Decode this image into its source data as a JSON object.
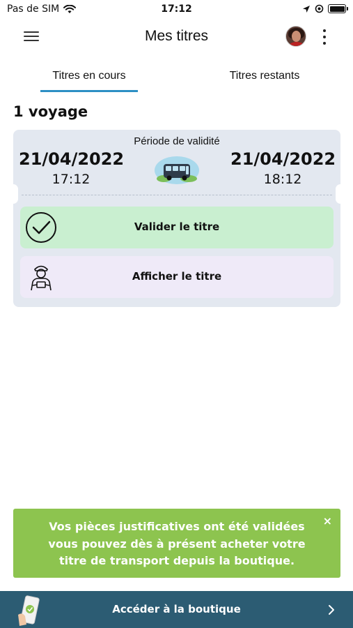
{
  "status_bar": {
    "carrier": "Pas de SIM",
    "time": "17:12"
  },
  "app_bar": {
    "title": "Mes titres"
  },
  "tabs": [
    {
      "label": "Titres en cours",
      "active": true
    },
    {
      "label": "Titres restants",
      "active": false
    }
  ],
  "section_title": "1 voyage",
  "ticket": {
    "validity_label": "Période de validité",
    "start_date": "21/04/2022",
    "start_time": "17:12",
    "end_date": "21/04/2022",
    "end_time": "18:12",
    "validate_label": "Valider le titre",
    "show_label": "Afficher le titre"
  },
  "notification": {
    "message": "Vos pièces justificatives ont été validées vous pouvez dès à présent acheter votre titre de transport depuis la boutique.",
    "close_symbol": "×"
  },
  "shop_bar": {
    "label": "Accéder à la boutique"
  },
  "icons": [
    "menu-icon",
    "avatar",
    "more-vertical-icon",
    "bus-icon",
    "check-circle-icon",
    "controller-icon",
    "close-icon",
    "phone-icon",
    "chevron-right-icon",
    "wifi-icon",
    "location-icon",
    "alarm-icon",
    "battery-icon"
  ],
  "colors": {
    "tab_underline": "#2d8fc4",
    "validate_bg": "#c9efd0",
    "show_bg": "#efeaf8",
    "ticket_bg": "#e3e8f0",
    "notice_bg": "#8dc44f",
    "shop_bar_bg": "#2c5c73"
  }
}
